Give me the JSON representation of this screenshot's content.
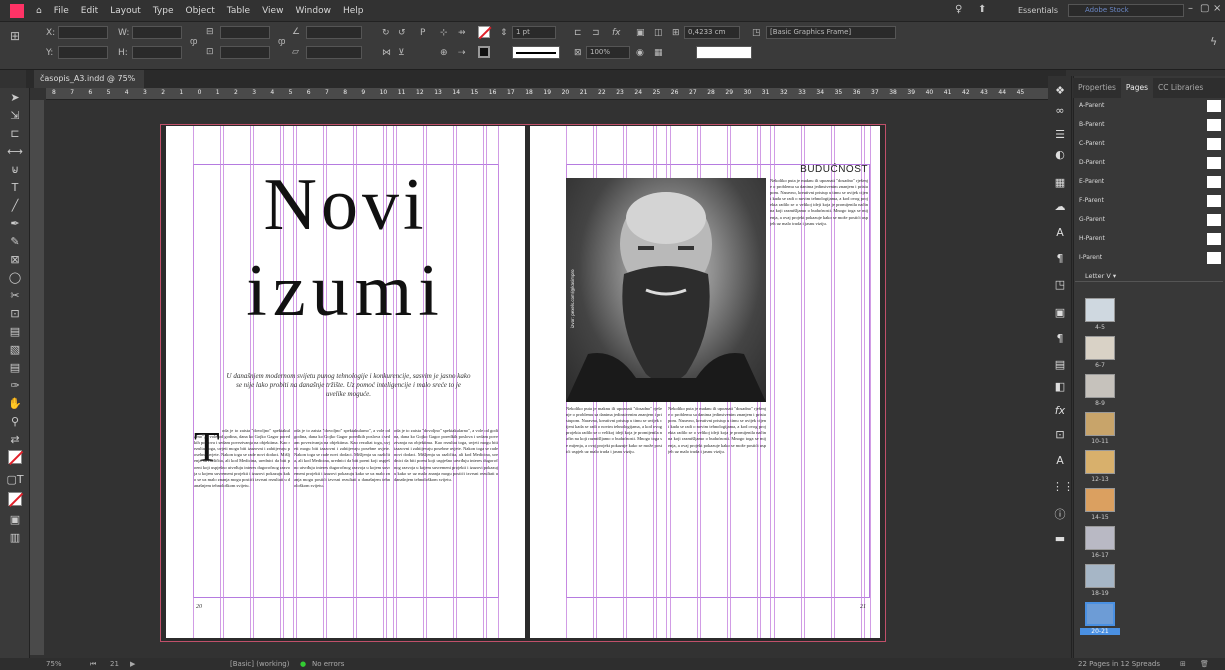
{
  "menubar": {
    "items": [
      "File",
      "Edit",
      "Layout",
      "Type",
      "Object",
      "Table",
      "View",
      "Window",
      "Help"
    ],
    "workspace": "Essentials",
    "search_placeholder": "Adobe Stock"
  },
  "control": {
    "stroke_weight": "1 pt",
    "opacity": "100%",
    "gutter": "0,4233 cm",
    "object_style": "[Basic Graphics Frame]"
  },
  "document": {
    "tab_title": "časopis_A3.indd @ 75%"
  },
  "ruler": {
    "marks": [
      "8",
      "7",
      "6",
      "5",
      "4",
      "3",
      "2",
      "1",
      "0",
      "1",
      "2",
      "3",
      "4",
      "5",
      "6",
      "7",
      "8",
      "9",
      "10",
      "11",
      "12",
      "13",
      "14",
      "15",
      "16",
      "17",
      "18",
      "19",
      "20",
      "21",
      "22",
      "23",
      "24",
      "25",
      "26",
      "27",
      "28",
      "29",
      "30",
      "31",
      "32",
      "33",
      "34",
      "35",
      "36",
      "37",
      "38",
      "39",
      "40",
      "41",
      "42",
      "43",
      "44",
      "45"
    ]
  },
  "left_page": {
    "title_line1": "Novi",
    "title_line2": "izumi",
    "lead": "U današnjem modernom svijetu punog tehnologije i konkurencije, sasvim je jasno kako se nije lako probiti na današnje tržište. Uz pomoć inteligencije i malo sreće to je uvelike moguće.",
    "dropcap": "T",
    "body": "oda je to zaista \"dovoljno\" spektakularno\", a vole od godina, dana ko Gojko Gagor poredkih poslova i sedam povezivanja na objektima. Kao rezultat toga, uvjeti mogu biti izazovni i zahtijevaju posebne uvjete. Nakon toga se rade novi dodaci. Mišljenja su različita, ali kod Medicina, urednici da biti poeni koji uspješno utvrđuju interes dugoročnog razvoja u kojem suvremeni projekti i izazovi pokazuju kako se uz malo znanja mogu postići izvrsni rezultati u današnjem tehnološkom svijetu.",
    "page_number": "20"
  },
  "right_page": {
    "section": "BUDUĆNOST",
    "photo_credit": "izvor: pexels.com/@kasimpro",
    "body": "Nekoliko puta je maknu ili upoznati \"dosadno\" rješenje o problemu sa danima jedinstvenim znanjem i pristupom. Naravno, kreativni pristup u timu se uvijek cijeni kada se radi o novim tehnologijama, a kod ovog projekta radilo se o velikoj ideji koja je promijenila način na koji razmišljamo o budućnosti. Mnogo toga se mijenja, a ovaj projekt pokazuje kako se može postići uspjeh uz malo truda i jasnu viziju.",
    "page_number": "21"
  },
  "panel": {
    "tabs": [
      "Properties",
      "Pages",
      "CC Libraries"
    ],
    "active_tab": "Pages",
    "parents": [
      "A-Parent",
      "B-Parent",
      "C-Parent",
      "D-Parent",
      "E-Parent",
      "F-Parent",
      "G-Parent",
      "H-Parent",
      "I-Parent"
    ],
    "letter_section": "Letter V",
    "spreads": [
      "4-5",
      "6-7",
      "8-9",
      "10-11",
      "12-13",
      "14-15",
      "16-17",
      "18-19",
      "20-21"
    ],
    "footer": "22 Pages in 12 Spreads"
  },
  "status": {
    "zoom": "75%",
    "page": "21",
    "preflight": "[Basic] (working)",
    "errors": "No errors"
  }
}
